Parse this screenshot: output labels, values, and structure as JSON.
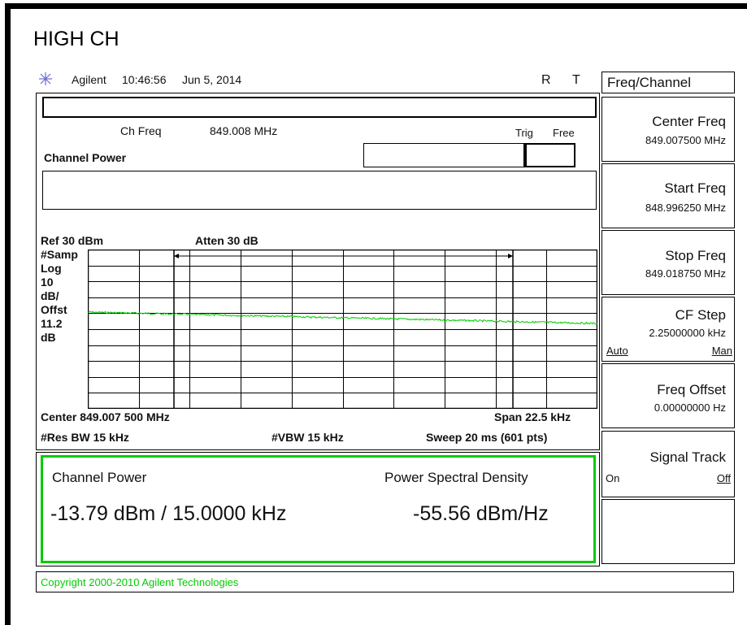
{
  "page_title": "HIGH CH",
  "header": {
    "brand": "Agilent",
    "time": "10:46:56",
    "date": "Jun 5, 2014",
    "flag_r": "R",
    "flag_t": "T"
  },
  "info": {
    "ch_freq_label": "Ch Freq",
    "ch_freq_value": "849.008 MHz",
    "trig_label": "Trig",
    "trig_value": "Free",
    "measurement_name": "Channel Power"
  },
  "display": {
    "ref": "Ref 30 dBm",
    "atten": "Atten 30 dB",
    "left_labels": [
      "#Samp",
      "Log",
      "10",
      "dB/",
      "Offst",
      "11.2",
      "dB"
    ],
    "center": "Center 849.007 500 MHz",
    "span": "Span 22.5 kHz",
    "res_bw": "#Res BW 15 kHz",
    "vbw": "#VBW 15 kHz",
    "sweep": "Sweep 20 ms (601 pts)",
    "trace_color": "#00cc00"
  },
  "results": {
    "channel_power_label": "Channel Power",
    "channel_power_value": "-13.79 dBm / 15.0000 kHz",
    "psd_label": "Power Spectral Density",
    "psd_value": "-55.56 dBm/Hz",
    "border_color": "#00cc00"
  },
  "status_bar": {
    "copyright": "Copyright 2000-2010 Agilent Technologies"
  },
  "softkeys": {
    "menu_title": "Freq/Channel",
    "center_freq": {
      "label": "Center Freq",
      "value": "849.007500 MHz"
    },
    "start_freq": {
      "label": "Start Freq",
      "value": "848.996250 MHz"
    },
    "stop_freq": {
      "label": "Stop Freq",
      "value": "849.018750 MHz"
    },
    "cf_step": {
      "label": "CF Step",
      "value": "2.25000000 kHz",
      "opt_auto": "Auto",
      "opt_man": "Man"
    },
    "freq_offset": {
      "label": "Freq Offset",
      "value": "0.00000000  Hz"
    },
    "signal_track": {
      "label": "Signal Track",
      "opt_on": "On",
      "opt_off": "Off"
    }
  }
}
